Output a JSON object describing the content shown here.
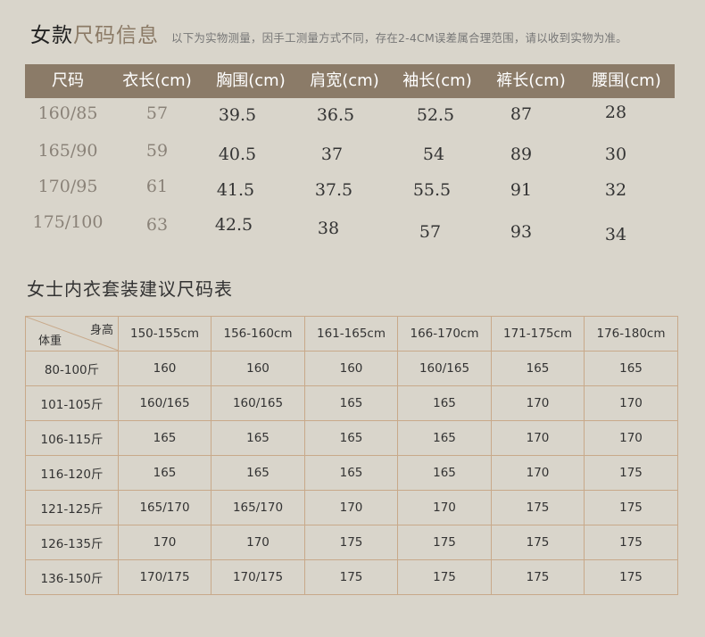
{
  "title": {
    "part1": "女款",
    "part2": "尺码信息",
    "note": "以下为实物测量，因手工测量方式不同，存在2-4CM误差属合理范围，请以收到实物为准。"
  },
  "size_table": {
    "headers": [
      "尺码",
      "衣长(cm)",
      "胸围(cm)",
      "肩宽(cm)",
      "袖长(cm)",
      "裤长(cm)",
      "腰围(cm)"
    ],
    "rows": [
      [
        "160/85",
        "57",
        "39.5",
        "36.5",
        "52.5",
        "87",
        "28"
      ],
      [
        "165/90",
        "59",
        "40.5",
        "37",
        "54",
        "89",
        "30"
      ],
      [
        "170/95",
        "61",
        "41.5",
        "37.5",
        "55.5",
        "91",
        "32"
      ],
      [
        "175/100",
        "63",
        "42.5",
        "38",
        "57",
        "93",
        "34"
      ]
    ]
  },
  "rec_table": {
    "title": "女士内衣套装建议尺码表",
    "corner_top": "身高",
    "corner_bottom": "体重",
    "heights": [
      "150-155cm",
      "156-160cm",
      "161-165cm",
      "166-170cm",
      "171-175cm",
      "176-180cm"
    ],
    "rows": [
      {
        "weight": "80-100斤",
        "sizes": [
          "160",
          "160",
          "160",
          "160/165",
          "165",
          "165"
        ]
      },
      {
        "weight": "101-105斤",
        "sizes": [
          "160/165",
          "160/165",
          "165",
          "165",
          "170",
          "170"
        ]
      },
      {
        "weight": "106-115斤",
        "sizes": [
          "165",
          "165",
          "165",
          "165",
          "170",
          "170"
        ]
      },
      {
        "weight": "116-120斤",
        "sizes": [
          "165",
          "165",
          "165",
          "165",
          "170",
          "175"
        ]
      },
      {
        "weight": "121-125斤",
        "sizes": [
          "165/170",
          "165/170",
          "170",
          "170",
          "175",
          "175"
        ]
      },
      {
        "weight": "126-135斤",
        "sizes": [
          "170",
          "170",
          "175",
          "175",
          "175",
          "175"
        ]
      },
      {
        "weight": "136-150斤",
        "sizes": [
          "170/175",
          "170/175",
          "175",
          "175",
          "175",
          "175"
        ]
      }
    ]
  }
}
